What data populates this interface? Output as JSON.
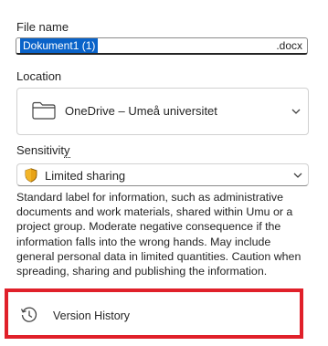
{
  "file_name": {
    "label": "File name",
    "value": "Dokument1 (1)",
    "extension": ".docx"
  },
  "location": {
    "label": "Location",
    "value": "OneDrive – Umeå universitet"
  },
  "sensitivity": {
    "label_main": "Sensitivit",
    "label_tail": "y",
    "value": "Limited sharing",
    "description": "Standard label for information, such as administrative documents and work materials, shared within Umu or a project group. Moderate negative consequence if the information falls into the wrong hands. May include general personal data in limited quantities. Caution when spreading, sharing and publishing the information."
  },
  "version_history": {
    "label": "Version History"
  },
  "colors": {
    "selection": "#0a63c9",
    "highlight": "#e0202a",
    "shield": "#e8a317"
  }
}
